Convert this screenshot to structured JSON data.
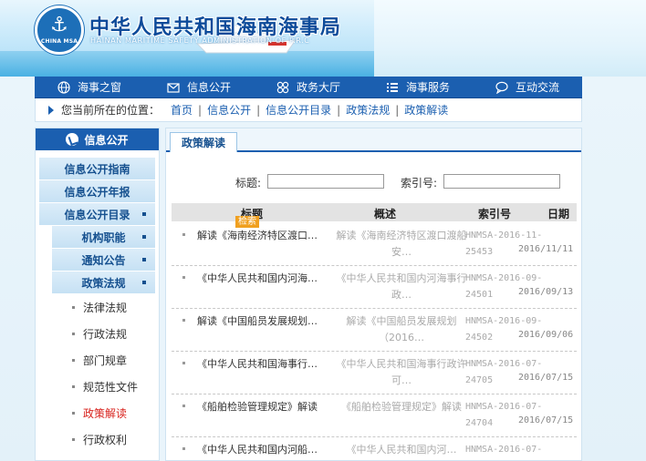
{
  "header": {
    "logo_text": "CHINA MSA",
    "site_title": "中华人民共和国海南海事局",
    "site_subtitle": "HAINAN MARITIME SAFETY ADMINISTRATION OF P.R.C"
  },
  "mainnav": [
    {
      "label": "海事之窗",
      "icon": "globe-icon"
    },
    {
      "label": "信息公开",
      "icon": "envelope-icon"
    },
    {
      "label": "政务大厅",
      "icon": "grid-icon"
    },
    {
      "label": "海事服务",
      "icon": "list-icon"
    },
    {
      "label": "互动交流",
      "icon": "chat-icon"
    }
  ],
  "breadcrumb": {
    "lead": "您当前所在的位置：",
    "items": [
      "首页",
      "信息公开",
      "信息公开目录",
      "政策法规",
      "政策解读"
    ],
    "sep": "|"
  },
  "sidebar": {
    "title": "信息公开",
    "items": [
      {
        "label": "信息公开指南"
      },
      {
        "label": "信息公开年报"
      },
      {
        "label": "信息公开目录"
      },
      {
        "label": "机构职能"
      },
      {
        "label": "通知公告"
      },
      {
        "label": "政策法规"
      }
    ],
    "leaves": [
      "法律法规",
      "行政法规",
      "部门规章",
      "规范性文件",
      "政策解读",
      "行政权利"
    ],
    "active_leaf": "政策解读"
  },
  "panel": {
    "tab": "政策解读",
    "search": {
      "title_label": "标题:",
      "index_label": "索引号:"
    },
    "search_tag": "检索",
    "columns": {
      "title": "标题",
      "summary": "概述",
      "index": "索引号",
      "date": "日期"
    },
    "rows": [
      {
        "title": "解读《海南经济特区渡口…",
        "summary": "解读《海南经济特区渡口渡船安…",
        "code": "HNMSA-2016-11-",
        "num": "25453",
        "date": "2016/11/11"
      },
      {
        "title": "《中华人民共和国内河海…",
        "summary": "《中华人民共和国内河海事行政…",
        "code": "HNMSA-2016-09-",
        "num": "24501",
        "date": "2016/09/13"
      },
      {
        "title": "解读《中国船员发展规划…",
        "summary": "解读《中国船员发展规划（2016…",
        "code": "HNMSA-2016-09-",
        "num": "24502",
        "date": "2016/09/06"
      },
      {
        "title": "《中华人民共和国海事行…",
        "summary": "《中华人民共和国海事行政许可…",
        "code": "HNMSA-2016-07-",
        "num": "24705",
        "date": "2016/07/15"
      },
      {
        "title": "《船舶检验管理规定》解读",
        "summary": "《船舶检验管理规定》解读",
        "code": "HNMSA-2016-07-",
        "num": "24704",
        "date": "2016/07/15"
      },
      {
        "title": "《中华人民共和国内河船…",
        "summary": "《中华人民共和国内河…",
        "code": "HNMSA-2016-07-",
        "num": "",
        "date": ""
      }
    ]
  }
}
